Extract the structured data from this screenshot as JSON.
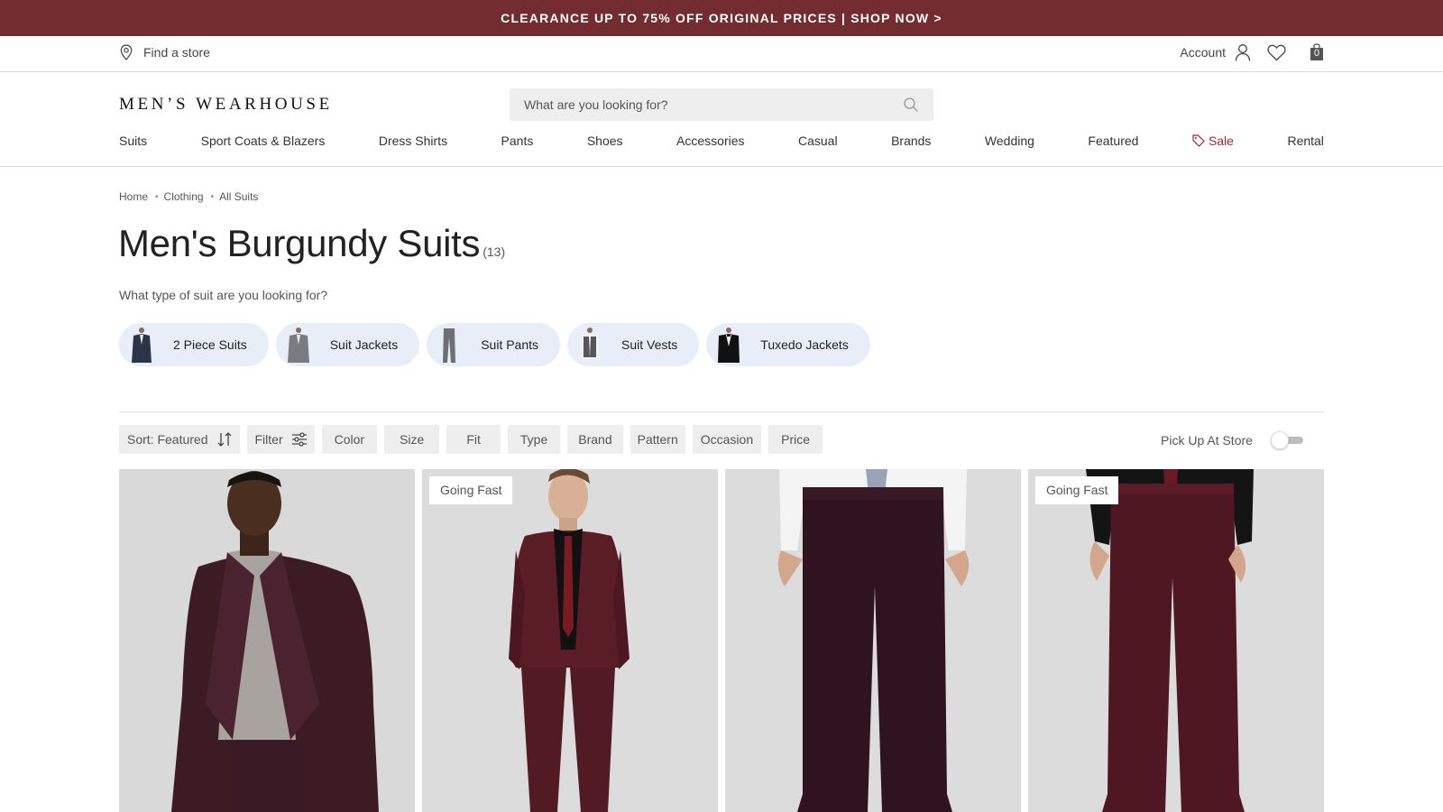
{
  "promo": {
    "text": "CLEARANCE UP TO 75% OFF ORIGINAL PRICES | SHOP NOW >"
  },
  "utility": {
    "find_store": "Find a store",
    "account": "Account",
    "cart_count": "0"
  },
  "brand": {
    "logo_text": "MEN’S WEARHOUSE"
  },
  "search": {
    "placeholder": "What are you looking for?"
  },
  "nav": {
    "items": [
      "Suits",
      "Sport Coats & Blazers",
      "Dress Shirts",
      "Pants",
      "Shoes",
      "Accessories",
      "Casual",
      "Brands",
      "Wedding",
      "Featured"
    ],
    "sale": "Sale",
    "rental": "Rental"
  },
  "breadcrumb": [
    "Home",
    "Clothing",
    "All Suits"
  ],
  "page": {
    "title": "Men's Burgundy Suits",
    "count": "(13)",
    "question": "What type of suit are you looking for?"
  },
  "suit_types": [
    {
      "label": "2 Piece Suits",
      "icon": "navy-suit-thumb"
    },
    {
      "label": "Suit Jackets",
      "icon": "grey-jacket-thumb"
    },
    {
      "label": "Suit Pants",
      "icon": "grey-pants-thumb"
    },
    {
      "label": "Suit Vests",
      "icon": "grey-vest-thumb"
    },
    {
      "label": "Tuxedo Jackets",
      "icon": "black-tuxedo-thumb"
    }
  ],
  "filters": {
    "sort": "Sort: Featured",
    "filter": "Filter",
    "facets": [
      "Color",
      "Size",
      "Fit",
      "Type",
      "Brand",
      "Pattern",
      "Occasion",
      "Price"
    ],
    "pickup": "Pick Up At Store"
  },
  "products": [
    {
      "badge": "",
      "image": "model-burgundy-jacket-grey-sweater"
    },
    {
      "badge": "Going Fast",
      "image": "model-burgundy-suit-black-shirt"
    },
    {
      "badge": "",
      "image": "burgundy-pants-white-shirt"
    },
    {
      "badge": "Going Fast",
      "image": "burgundy-pants-black-shirt"
    }
  ],
  "colors": {
    "promo": "#732d30",
    "sale": "#b0242d",
    "burgundy": "#4a1a24",
    "pill": "#e7eef8"
  }
}
